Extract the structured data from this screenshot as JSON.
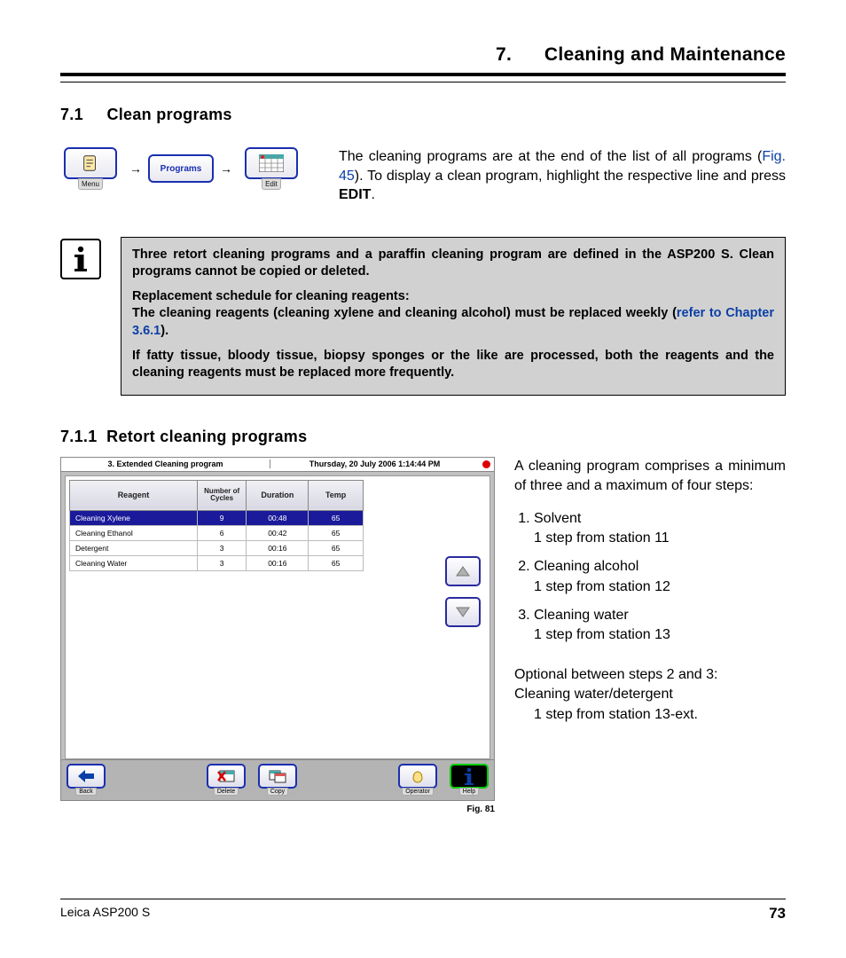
{
  "chapter": {
    "number": "7.",
    "title": "Cleaning and Maintenance"
  },
  "section_7_1": {
    "number": "7.1",
    "title": "Clean programs"
  },
  "nav": {
    "menu_label": "Menu",
    "programs_label": "Programs",
    "edit_label": "Edit",
    "arrow": "→"
  },
  "intro_para": {
    "text1": "The cleaning programs are at the end of the list of all programs (",
    "link": "Fig. 45",
    "text2": "). To display a clean program, highlight the respective line and press ",
    "edit": "EDIT",
    "text3": "."
  },
  "info": {
    "p1": "Three retort cleaning programs and a paraffin cleaning program are defined in the ASP200 S. Clean programs cannot be copied or deleted.",
    "p2a": "Replacement schedule for cleaning reagents:",
    "p2b_a": "The cleaning reagents (cleaning xylene and cleaning alcohol) must be replaced weekly (",
    "p2b_link": "refer to Chapter 3.6.1",
    "p2b_b": ").",
    "p3": "If fatty tissue, bloody tissue, biopsy sponges or the like are processed, both the reagents and the cleaning reagents must be replaced more frequently."
  },
  "section_7_1_1": {
    "number": "7.1.1",
    "title": "Retort cleaning programs"
  },
  "screenshot": {
    "title_left": "3. Extended Cleaning program",
    "title_right": "Thursday, 20 July 2006 1:14:44 PM",
    "headers": {
      "reagent": "Reagent",
      "cycles": "Number of Cycles",
      "duration": "Duration",
      "temp": "Temp"
    },
    "rows": [
      {
        "reagent": "Cleaning Xylene",
        "cycles": "9",
        "duration": "00:48",
        "temp": "65",
        "selected": true
      },
      {
        "reagent": "Cleaning Ethanol",
        "cycles": "6",
        "duration": "00:42",
        "temp": "65"
      },
      {
        "reagent": "Detergent",
        "cycles": "3",
        "duration": "00:16",
        "temp": "65"
      },
      {
        "reagent": "Cleaning Water",
        "cycles": "3",
        "duration": "00:16",
        "temp": "65"
      }
    ],
    "bottom": {
      "back": "Back",
      "delete": "Delete",
      "copy": "Copy",
      "operator": "Operator",
      "help": "Help"
    },
    "caption": "Fig. 81"
  },
  "right_text": {
    "intro": "A cleaning program comprises a minimum of three and a maximum of four steps:",
    "steps": [
      {
        "title": "Solvent",
        "sub": "1 step from station 11"
      },
      {
        "title": "Cleaning alcohol",
        "sub": "1 step from station 12"
      },
      {
        "title": "Cleaning water",
        "sub": "1 step from station 13"
      }
    ],
    "optional_a": "Optional between steps 2 and 3:",
    "optional_b": "Cleaning water/detergent",
    "optional_c": "1 step from station 13-ext."
  },
  "footer": {
    "product": "Leica ASP200 S",
    "page": "73"
  }
}
